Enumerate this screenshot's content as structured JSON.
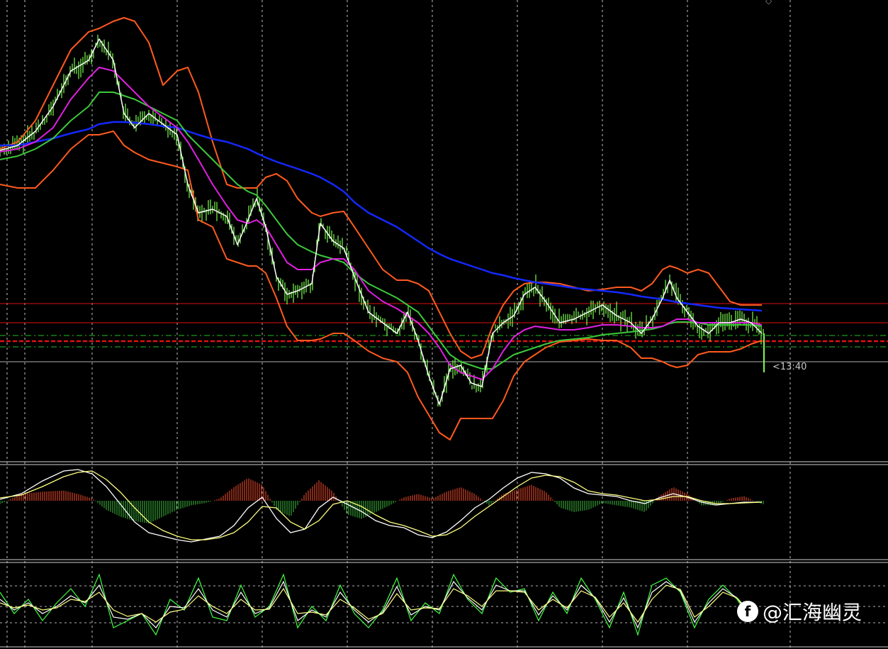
{
  "window": {
    "corner_glyph": "◇"
  },
  "price_label": "<13:40",
  "watermark": {
    "icon": "f",
    "text": "@汇海幽灵"
  },
  "colors": {
    "background": "#000000",
    "candles": "#7CFC4F",
    "close_line": "#ffffff",
    "bollinger": "#ff5a1e",
    "ma_fast": "#ff8c5a",
    "ma_magenta": "#e020e0",
    "ma_green": "#3cc83c",
    "ma_blue": "#1428ff",
    "level_red": "#e01010",
    "level_green_dash": "#20c020",
    "macd_pos": "#ff5030",
    "macd_neg": "#40c040",
    "macd_line": "#ffffff",
    "signal_line": "#ffff80",
    "stoch_green": "#40ff40",
    "stoch_white": "#ffffff",
    "stoch_yellow": "#ffff80",
    "grid": "#ffffff"
  },
  "chart_data": [
    {
      "type": "line",
      "panel": "price",
      "x": [
        0,
        25,
        50,
        75,
        100,
        125,
        140,
        160,
        175,
        190,
        210,
        230,
        250,
        265,
        280,
        300,
        320,
        335,
        350,
        362,
        375,
        390,
        405,
        420,
        440,
        452,
        470,
        485,
        500,
        520,
        540,
        560,
        575,
        590,
        605,
        620,
        635,
        650,
        665,
        680,
        695,
        710,
        725,
        740,
        755,
        770,
        790,
        810,
        830,
        850,
        870,
        890,
        905,
        920,
        935,
        945,
        955,
        970,
        985,
        1000,
        1015,
        1030,
        1045,
        1060,
        1075
      ],
      "series": [
        {
          "role": "close",
          "values": [
            212,
            205,
            185,
            150,
            100,
            85,
            55,
            85,
            160,
            180,
            160,
            175,
            190,
            260,
            300,
            295,
            305,
            345,
            310,
            280,
            320,
            390,
            415,
            410,
            400,
            315,
            340,
            350,
            390,
            440,
            455,
            470,
            440,
            480,
            530,
            570,
            520,
            515,
            540,
            545,
            470,
            455,
            445,
            415,
            405,
            425,
            455,
            450,
            440,
            430,
            445,
            455,
            470,
            450,
            420,
            395,
            420,
            440,
            460,
            470,
            455,
            455,
            450,
            455,
            470
          ]
        },
        {
          "role": "ma_magenta",
          "values": [
            214,
            210,
            200,
            180,
            140,
            110,
            95,
            100,
            115,
            130,
            150,
            165,
            180,
            200,
            225,
            260,
            290,
            310,
            315,
            310,
            320,
            345,
            370,
            380,
            380,
            370,
            365,
            365,
            380,
            410,
            425,
            435,
            445,
            455,
            470,
            490,
            515,
            525,
            530,
            535,
            520,
            495,
            475,
            465,
            460,
            462,
            465,
            465,
            462,
            458,
            458,
            460,
            462,
            462,
            460,
            455,
            450,
            450,
            455,
            455,
            455,
            455,
            455,
            455,
            458
          ]
        },
        {
          "role": "ma_green",
          "values": [
            225,
            220,
            210,
            195,
            170,
            150,
            130,
            130,
            135,
            140,
            150,
            160,
            170,
            190,
            205,
            225,
            245,
            260,
            270,
            275,
            290,
            310,
            330,
            345,
            355,
            360,
            365,
            370,
            385,
            400,
            410,
            420,
            430,
            440,
            460,
            480,
            500,
            510,
            515,
            520,
            520,
            510,
            500,
            495,
            490,
            485,
            480,
            478,
            476,
            472,
            470,
            468,
            466,
            464,
            460,
            456,
            454,
            454,
            455,
            458,
            458,
            458,
            458,
            458,
            460
          ]
        },
        {
          "role": "ma_blue",
          "values": [
            205,
            205,
            200,
            195,
            188,
            182,
            175,
            172,
            172,
            173,
            175,
            178,
            180,
            185,
            190,
            196,
            200,
            205,
            210,
            216,
            222,
            228,
            233,
            238,
            245,
            250,
            260,
            270,
            285,
            300,
            310,
            320,
            330,
            340,
            350,
            358,
            365,
            370,
            375,
            380,
            385,
            388,
            392,
            395,
            398,
            400,
            403,
            406,
            408,
            410,
            412,
            415,
            418,
            420,
            422,
            424,
            426,
            428,
            430,
            432,
            434,
            435,
            436,
            437,
            438
          ]
        },
        {
          "role": "bb_upper",
          "values": [
            210,
            200,
            170,
            120,
            70,
            45,
            40,
            30,
            25,
            30,
            60,
            120,
            100,
            95,
            130,
            200,
            260,
            265,
            265,
            265,
            250,
            245,
            255,
            280,
            300,
            305,
            300,
            298,
            320,
            350,
            380,
            395,
            395,
            400,
            410,
            440,
            470,
            495,
            505,
            500,
            460,
            430,
            410,
            400,
            398,
            398,
            400,
            405,
            410,
            408,
            405,
            405,
            410,
            400,
            380,
            375,
            378,
            385,
            380,
            385,
            405,
            425,
            430,
            430,
            430
          ]
        },
        {
          "role": "bb_lower",
          "values": [
            260,
            265,
            265,
            240,
            210,
            190,
            190,
            185,
            205,
            215,
            225,
            230,
            235,
            240,
            310,
            320,
            365,
            370,
            375,
            375,
            385,
            420,
            460,
            480,
            480,
            478,
            470,
            470,
            480,
            495,
            505,
            510,
            525,
            560,
            585,
            610,
            620,
            590,
            590,
            590,
            590,
            565,
            530,
            510,
            500,
            490,
            482,
            480,
            478,
            480,
            480,
            490,
            505,
            505,
            510,
            515,
            518,
            515,
            500,
            496,
            496,
            496,
            492,
            485,
            480
          ]
        }
      ],
      "levels": [
        {
          "style": "red",
          "value": 428
        },
        {
          "style": "red",
          "value": 455
        },
        {
          "style": "red_thick_dash",
          "value": 481
        },
        {
          "style": "green_dash",
          "value": 473
        },
        {
          "style": "green_dash",
          "value": 489
        },
        {
          "style": "grey",
          "value": 510
        }
      ]
    },
    {
      "type": "bar",
      "panel": "macd",
      "x": [
        0,
        30,
        60,
        90,
        110,
        130,
        150,
        170,
        190,
        210,
        230,
        250,
        270,
        290,
        310,
        330,
        350,
        370,
        390,
        410,
        430,
        450,
        470,
        490,
        510,
        530,
        550,
        570,
        590,
        610,
        630,
        650,
        670,
        690,
        710,
        730,
        750,
        770,
        790,
        810,
        830,
        850,
        870,
        890,
        910,
        930,
        950,
        970,
        990,
        1010,
        1030,
        1050,
        1075
      ],
      "series": [
        {
          "role": "histogram",
          "values": [
            -3,
            6,
            8,
            9,
            6,
            2,
            -8,
            -14,
            -18,
            -20,
            -14,
            -8,
            -4,
            -2,
            2,
            12,
            20,
            14,
            -8,
            -14,
            6,
            18,
            8,
            -12,
            -16,
            -10,
            -4,
            3,
            6,
            2,
            8,
            12,
            6,
            -4,
            6,
            10,
            14,
            8,
            -6,
            -10,
            -8,
            -2,
            -4,
            -6,
            -10,
            4,
            12,
            6,
            -4,
            -4,
            2,
            4,
            -3
          ]
        },
        {
          "role": "macd_line",
          "values": [
            2,
            10,
            28,
            42,
            44,
            38,
            20,
            -5,
            -30,
            -45,
            -50,
            -55,
            -58,
            -54,
            -50,
            -35,
            -10,
            5,
            -25,
            -45,
            -40,
            -10,
            5,
            -5,
            -15,
            -28,
            -35,
            -38,
            -48,
            -52,
            -44,
            -28,
            -10,
            2,
            18,
            32,
            40,
            38,
            32,
            18,
            10,
            8,
            6,
            0,
            -4,
            4,
            10,
            5,
            -2,
            -6,
            -4,
            -2,
            -2
          ]
        },
        {
          "role": "signal_line",
          "values": [
            4,
            8,
            20,
            34,
            40,
            42,
            30,
            12,
            -10,
            -30,
            -42,
            -50,
            -55,
            -55,
            -52,
            -45,
            -30,
            -8,
            -10,
            -30,
            -40,
            -28,
            -5,
            0,
            -8,
            -20,
            -30,
            -35,
            -42,
            -50,
            -48,
            -38,
            -22,
            -8,
            6,
            20,
            32,
            36,
            34,
            26,
            14,
            10,
            8,
            4,
            0,
            2,
            6,
            6,
            0,
            -4,
            -4,
            -3,
            -2
          ]
        }
      ]
    },
    {
      "type": "line",
      "panel": "stochastic",
      "x": [
        0,
        20,
        40,
        60,
        80,
        100,
        120,
        140,
        160,
        180,
        200,
        220,
        240,
        260,
        280,
        300,
        320,
        340,
        360,
        380,
        400,
        420,
        440,
        460,
        480,
        500,
        520,
        540,
        560,
        580,
        600,
        620,
        640,
        660,
        680,
        700,
        720,
        740,
        760,
        780,
        800,
        820,
        840,
        860,
        880,
        900,
        920,
        940,
        960,
        980,
        1000,
        1020,
        1040,
        1060
      ],
      "series": [
        {
          "role": "k_line",
          "values": [
            70,
            40,
            60,
            30,
            55,
            75,
            50,
            95,
            20,
            30,
            40,
            10,
            60,
            45,
            90,
            35,
            30,
            80,
            35,
            50,
            95,
            20,
            50,
            30,
            80,
            40,
            20,
            45,
            90,
            30,
            55,
            40,
            95,
            60,
            40,
            90,
            70,
            75,
            30,
            70,
            40,
            90,
            60,
            20,
            70,
            10,
            80,
            90,
            70,
            20,
            60,
            80,
            60,
            30
          ]
        },
        {
          "role": "d_line",
          "values": [
            60,
            45,
            55,
            40,
            50,
            65,
            55,
            80,
            35,
            32,
            40,
            20,
            50,
            48,
            75,
            45,
            35,
            70,
            40,
            48,
            85,
            30,
            45,
            35,
            70,
            45,
            28,
            42,
            78,
            38,
            50,
            45,
            85,
            62,
            45,
            80,
            72,
            72,
            38,
            65,
            45,
            80,
            62,
            28,
            62,
            20,
            70,
            85,
            72,
            28,
            55,
            75,
            62,
            35
          ]
        },
        {
          "role": "signal",
          "values": [
            55,
            48,
            52,
            45,
            48,
            60,
            57,
            70,
            45,
            36,
            40,
            28,
            42,
            46,
            65,
            50,
            40,
            60,
            45,
            46,
            75,
            40,
            42,
            38,
            60,
            48,
            32,
            40,
            68,
            45,
            48,
            47,
            75,
            65,
            50,
            72,
            72,
            70,
            45,
            60,
            48,
            72,
            63,
            35,
            55,
            28,
            60,
            80,
            74,
            35,
            50,
            70,
            62,
            40
          ]
        }
      ]
    }
  ]
}
